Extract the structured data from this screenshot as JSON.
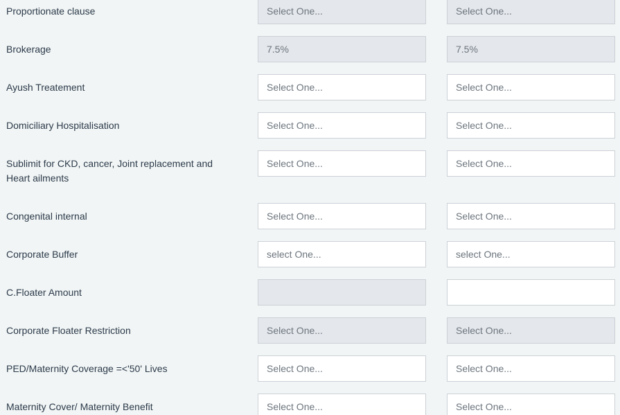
{
  "rows": [
    {
      "label": "Proportionate clause",
      "col1": "Select One...",
      "col2": "Select One...",
      "col1_disabled": true,
      "col2_disabled": true
    },
    {
      "label": "Brokerage",
      "col1": "7.5%",
      "col2": "7.5%",
      "col1_disabled": true,
      "col2_disabled": true
    },
    {
      "label": "Ayush Treatement",
      "col1": "Select One...",
      "col2": "Select One...",
      "col1_disabled": false,
      "col2_disabled": false
    },
    {
      "label": "Domiciliary Hospitalisation",
      "col1": "Select One...",
      "col2": "Select One...",
      "col1_disabled": false,
      "col2_disabled": false
    },
    {
      "label": "Sublimit for CKD, cancer, Joint replacement and Heart ailments",
      "col1": "Select One...",
      "col2": "Select One...",
      "col1_disabled": false,
      "col2_disabled": false
    },
    {
      "label": "Congenital internal",
      "col1": "Select One...",
      "col2": "Select One...",
      "col1_disabled": false,
      "col2_disabled": false
    },
    {
      "label": "Corporate Buffer",
      "col1": "select One...",
      "col2": "select One...",
      "col1_disabled": false,
      "col2_disabled": false
    },
    {
      "label": "C.Floater Amount",
      "col1": "",
      "col2": "",
      "col1_disabled": true,
      "col2_disabled": false
    },
    {
      "label": "Corporate Floater Restriction",
      "col1": "Select One...",
      "col2": "Select One...",
      "col1_disabled": true,
      "col2_disabled": true
    },
    {
      "label": "PED/Maternity Coverage =<'50' Lives",
      "col1": "Select One...",
      "col2": "Select One...",
      "col1_disabled": false,
      "col2_disabled": false
    },
    {
      "label": "Maternity Cover/ Maternity Benefit",
      "col1": "Select One...",
      "col2": "Select One...",
      "col1_disabled": false,
      "col2_disabled": false
    }
  ]
}
